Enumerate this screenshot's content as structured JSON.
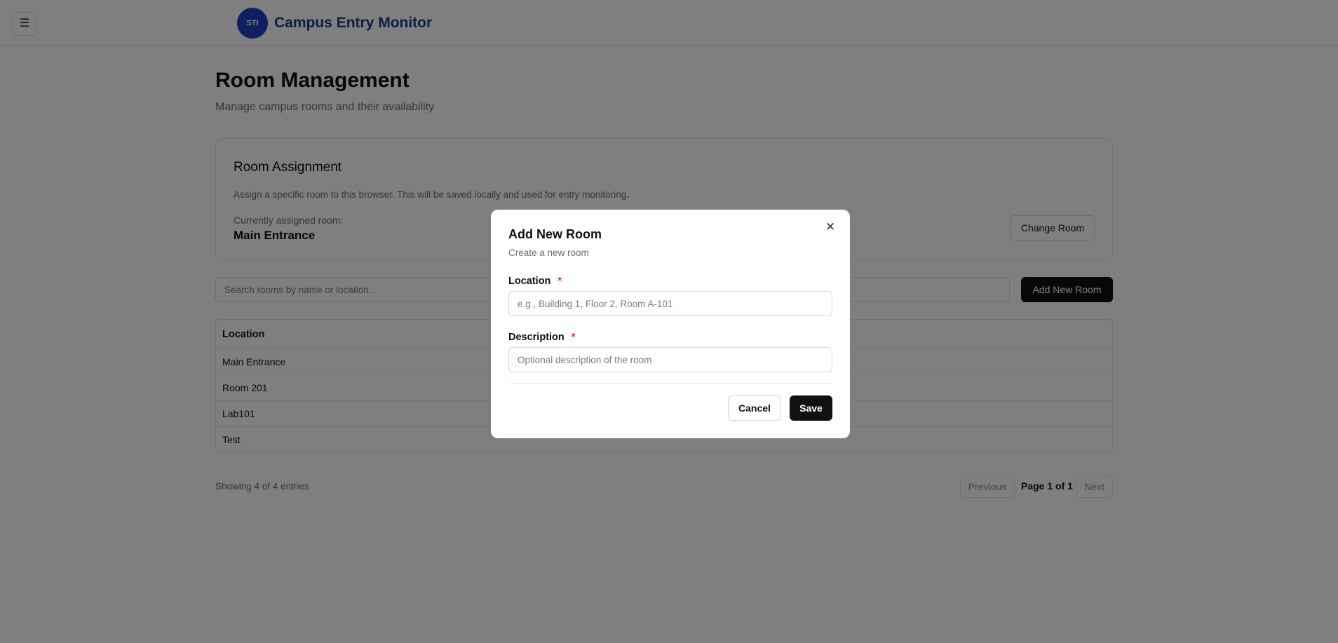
{
  "header": {
    "menu_icon": "hamburger-icon",
    "menu_glyph": "☰",
    "logo_text": "STI",
    "app_title": "Campus Entry Monitor"
  },
  "page": {
    "title": "Room Management",
    "subtitle": "Manage campus rooms and their availability"
  },
  "assignment": {
    "title": "Room Assignment",
    "description": "Assign a specific room to this browser. This will be saved locally and used for entry monitoring.",
    "current_label": "Currently assigned room:",
    "current_value": "Main Entrance",
    "change_button": "Change Room"
  },
  "search": {
    "placeholder": "Search rooms by name or location..."
  },
  "toolbar": {
    "add_button": "Add New Room"
  },
  "table": {
    "column_location": "Location",
    "rows": [
      {
        "location": "Main Entrance"
      },
      {
        "location": "Room 201"
      },
      {
        "location": "Lab101"
      },
      {
        "location": "Test"
      }
    ]
  },
  "pagination": {
    "entries_text": "Showing 4 of 4 entries",
    "previous": "Previous",
    "page_info": "Page 1 of 1",
    "next": "Next"
  },
  "modal": {
    "title": "Add New Room",
    "subtitle": "Create a new room",
    "close_glyph": "✕",
    "location_label": "Location",
    "location_placeholder": "e.g., Building 1, Floor 2, Room A-101",
    "description_label": "Description",
    "description_placeholder": "Optional description of the room",
    "required_mark": "*",
    "cancel": "Cancel",
    "save": "Save"
  },
  "colors": {
    "brand": "#1e3a8a",
    "primary_button": "#111111",
    "required": "#e03030"
  }
}
